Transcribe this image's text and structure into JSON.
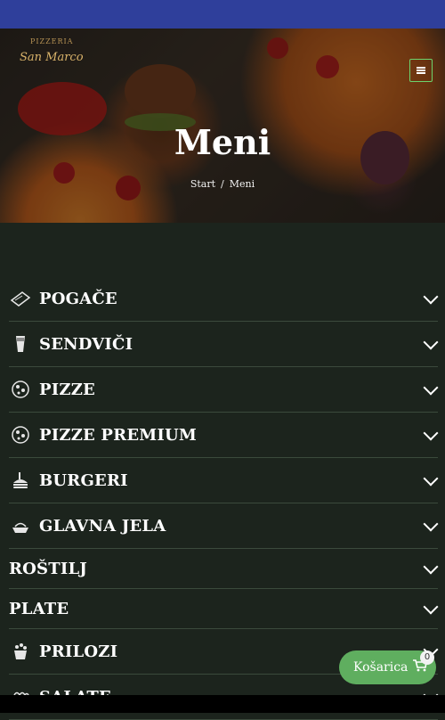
{
  "header": {
    "logo_small": "PIZZERIA",
    "logo_big": "San Marco",
    "page_title": "Meni",
    "breadcrumb": {
      "home": "Start",
      "separator": "/",
      "current": "Meni"
    }
  },
  "categories": [
    {
      "label": "POGAČE",
      "icon": "flatbread-icon"
    },
    {
      "label": "SENDVIČI",
      "icon": "drink-glass-icon"
    },
    {
      "label": "PIZZE",
      "icon": "pizza-icon"
    },
    {
      "label": "PIZZE PREMIUM",
      "icon": "pizza-icon"
    },
    {
      "label": "BURGERI",
      "icon": "burger-icon"
    },
    {
      "label": "GLAVNA JELA",
      "icon": "main-dish-icon"
    },
    {
      "label": "ROŠTILJ",
      "icon": ""
    },
    {
      "label": "PLATE",
      "icon": ""
    },
    {
      "label": "PRILOZI",
      "icon": "side-dish-icon"
    },
    {
      "label": "SALATE",
      "icon": "salad-bowl-icon"
    }
  ],
  "cart": {
    "label": "Košarica",
    "count": "0"
  },
  "colors": {
    "status_bar": "#2f3f9b",
    "background": "#1c241d",
    "accent": "#5fae5f"
  }
}
